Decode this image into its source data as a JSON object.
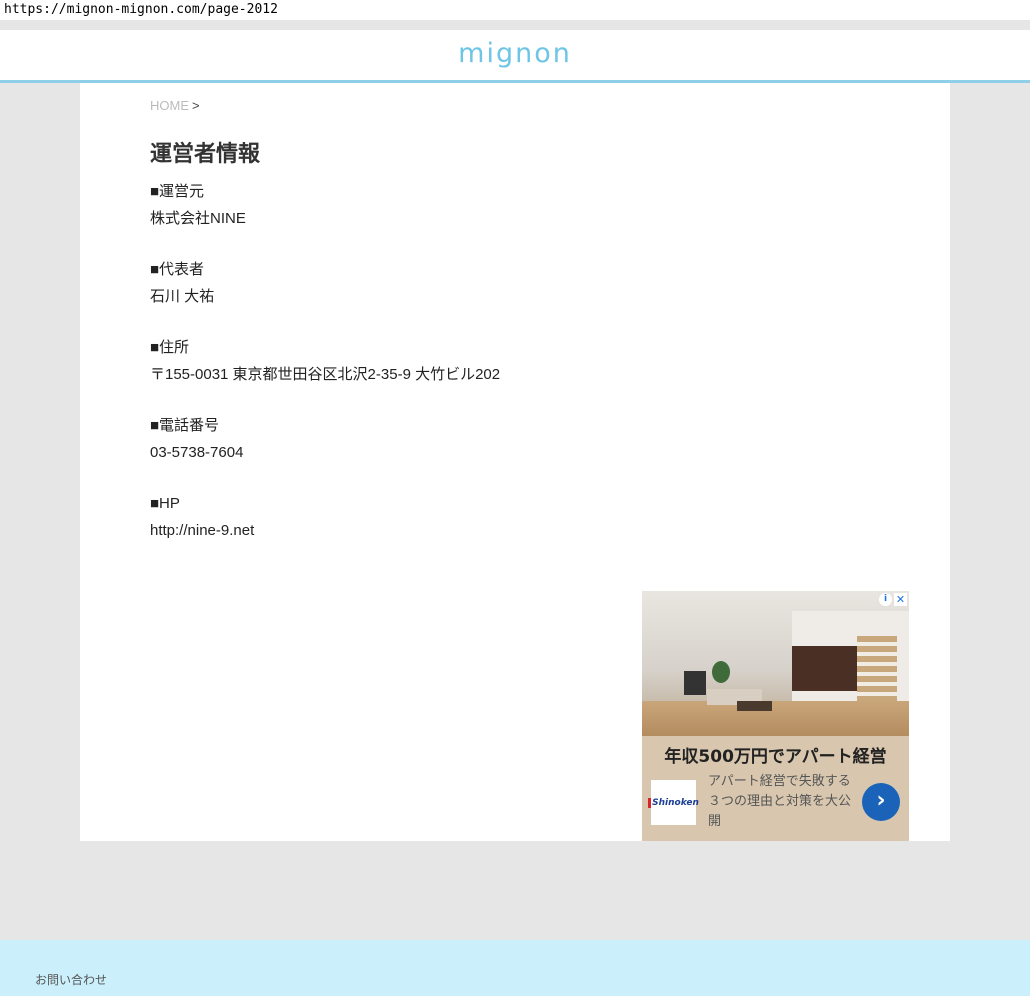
{
  "browser": {
    "url": "https://mignon-mignon.com/page-2012"
  },
  "header": {
    "logo": "mignon"
  },
  "breadcrumb": {
    "home": "HOME",
    "separator": ">"
  },
  "page": {
    "title": "運営者情報",
    "sections": [
      {
        "label": "■運営元",
        "value": "株式会社NINE"
      },
      {
        "label": "■代表者",
        "value": "石川 大祐"
      },
      {
        "label": "■住所",
        "value": "〒155-0031 東京都世田谷区北沢2-35-9 大竹ビル202"
      },
      {
        "label": "■電話番号",
        "value": "03-5738-7604"
      },
      {
        "label": "■HP",
        "value": "http://nine-9.net"
      }
    ]
  },
  "ad": {
    "headline": "年収500万円でアパート経営",
    "description": "アパート経営で失敗する３つの理由と対策を大公開",
    "brand": "Shinoken",
    "info_icon": "i",
    "close_icon": "✕",
    "arrow_icon": "›"
  },
  "footer": {
    "contact": "お問い合わせ"
  },
  "colors": {
    "accent": "#6fc5e6",
    "header_border": "#8fd0e8",
    "footer_bg": "#cbf0fc",
    "ad_button": "#1a63b8"
  }
}
